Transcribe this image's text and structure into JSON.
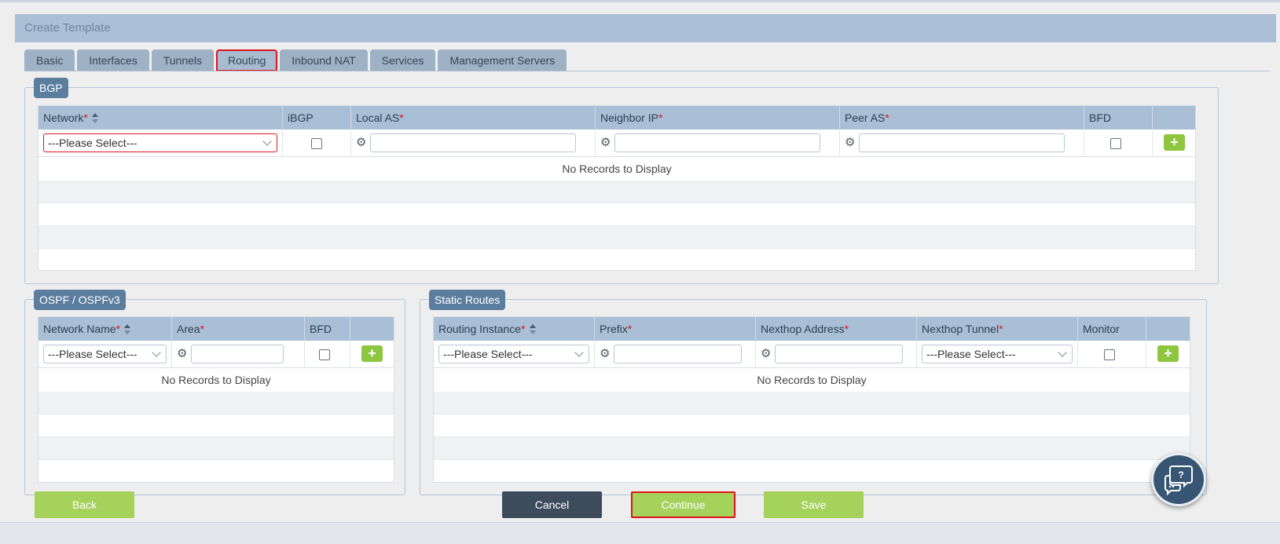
{
  "header": {
    "title": "Create Template"
  },
  "tabs": [
    {
      "label": "Basic",
      "active": false
    },
    {
      "label": "Interfaces",
      "active": false
    },
    {
      "label": "Tunnels",
      "active": false
    },
    {
      "label": "Routing",
      "active": true
    },
    {
      "label": "Inbound NAT",
      "active": false
    },
    {
      "label": "Services",
      "active": false
    },
    {
      "label": "Management Servers",
      "active": false
    }
  ],
  "bgp": {
    "legend": "BGP",
    "columns": {
      "network": "Network",
      "ibgp": "iBGP",
      "local_as": "Local AS",
      "neighbor_ip": "Neighbor IP",
      "peer_as": "Peer AS",
      "bfd": "BFD"
    },
    "network_select": "---Please Select---",
    "local_as_value": "",
    "neighbor_ip_value": "",
    "peer_as_value": "",
    "ibgp_checked": false,
    "bfd_checked": false,
    "add_label": "+",
    "empty": "No Records to Display"
  },
  "ospf": {
    "legend": "OSPF / OSPFv3",
    "columns": {
      "network_name": "Network Name",
      "area": "Area",
      "bfd": "BFD"
    },
    "network_select": "---Please Select---",
    "area_value": "",
    "bfd_checked": false,
    "add_label": "+",
    "empty": "No Records to Display"
  },
  "static_routes": {
    "legend": "Static Routes",
    "columns": {
      "routing_instance": "Routing Instance",
      "prefix": "Prefix",
      "nexthop_address": "Nexthop Address",
      "nexthop_tunnel": "Nexthop Tunnel",
      "monitor": "Monitor"
    },
    "routing_instance_select": "---Please Select---",
    "prefix_value": "",
    "nexthop_address_value": "",
    "nexthop_tunnel_select": "---Please Select---",
    "monitor_checked": false,
    "add_label": "+",
    "empty": "No Records to Display"
  },
  "footer": {
    "back": "Back",
    "cancel": "Cancel",
    "continue": "Continue",
    "save": "Save"
  },
  "help": {
    "icon": "help-chat-icon",
    "glyph": "?"
  },
  "colors": {
    "accent_green": "#a5d25b",
    "header_blue": "#a8bfd6",
    "legend_blue": "#5b7e9e",
    "highlight_red": "#e0131c"
  }
}
